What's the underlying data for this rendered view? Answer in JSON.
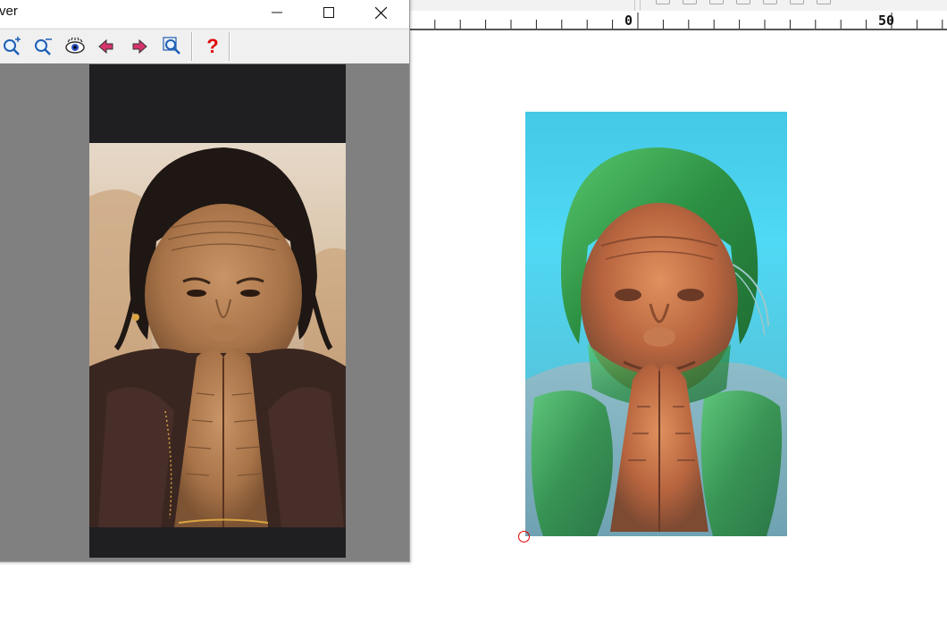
{
  "viewer": {
    "title": "ver",
    "controls": {
      "minimize": "—",
      "maximize": "☐",
      "close": "✕"
    },
    "toolbar": {
      "help_glyph": "?"
    },
    "icons": [
      "zoom-in-icon",
      "zoom-out-icon",
      "eye-icon",
      "previous-arrow-icon",
      "next-arrow-icon",
      "zoom-fit-icon",
      "help-icon"
    ]
  },
  "ruler": {
    "labels": [
      "0",
      "50"
    ]
  },
  "colors": {
    "help_red": "#e00000",
    "relief_cyan": "#4fd9f5",
    "relief_green": "#2f9a46",
    "relief_skin": "#c0704a",
    "origin_marker": "#e00000",
    "viewer_bg": "#808080"
  }
}
